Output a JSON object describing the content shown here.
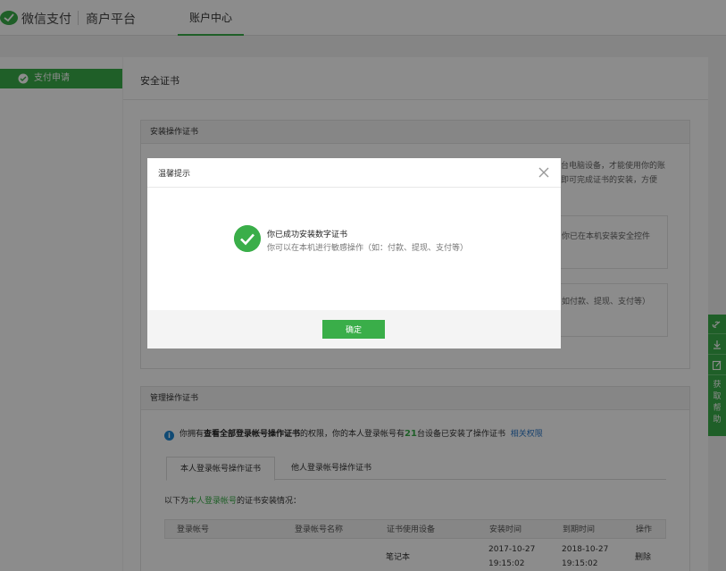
{
  "header": {
    "brand": "微信支付",
    "brand_sub": "商户平台",
    "nav_tab": "账户中心"
  },
  "sidebar": {
    "items": [
      {
        "label": "支付申请"
      }
    ]
  },
  "main": {
    "page_title": "安全证书",
    "install_section": {
      "title": "安装操作证书",
      "bg_text_1": "台电脑设备，才能使用你的账",
      "bg_text_2": "即可完成证书的安装，方便",
      "box1_text": "你已在本机安装安全控件",
      "box2_text": "如付款、提现、支付等）"
    },
    "manage_section": {
      "title": "管理操作证书",
      "info_pre": "你拥有",
      "info_bold": "查看全部登录帐号操作证书",
      "info_mid": "的权限，你的本人登录帐号有",
      "info_count": "21",
      "info_post": "台设备已安装了操作证书",
      "info_link": "相关权限",
      "tabs": [
        {
          "label": "本人登录帐号操作证书"
        },
        {
          "label": "他人登录帐号操作证书"
        }
      ],
      "sub_pre": "以下为",
      "sub_highlight": "本人登录帐号",
      "sub_post": "的证书安装情况：",
      "table": {
        "headers": [
          "登录帐号",
          "登录帐号名称",
          "证书使用设备",
          "安装时间",
          "到期时间",
          "操作"
        ],
        "rows": [
          {
            "device": "笔记本",
            "install_date": "2017-10-27",
            "install_time": "19:15:02",
            "expire_date": "2018-10-27",
            "expire_time": "19:15:02",
            "action": "删除"
          }
        ]
      }
    }
  },
  "helpbar": {
    "icons": [
      "link-icon",
      "download-icon",
      "edit-icon"
    ],
    "label": [
      "获",
      "取",
      "帮",
      "助"
    ]
  },
  "dialog": {
    "title": "温馨提示",
    "message_title": "你已成功安装数字证书",
    "message_sub": "你可以在本机进行敏感操作（如：付款、提现、支付等）",
    "confirm_label": "确定"
  },
  "colors": {
    "accent": "#3aae49",
    "link": "#2a77c7",
    "info": "#1e88d4"
  }
}
